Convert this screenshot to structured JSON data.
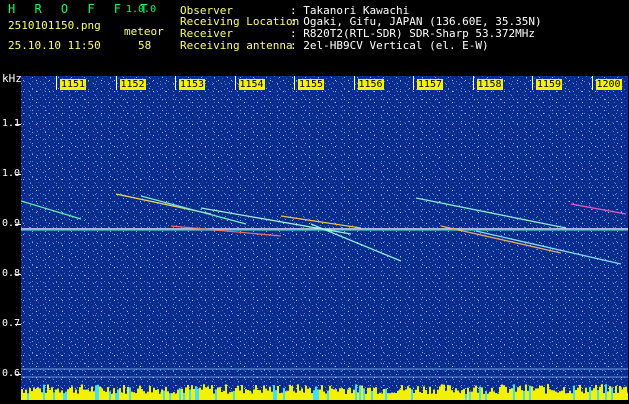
{
  "header": {
    "app_title": "H R O F F T",
    "app_version": "1.0.0",
    "filename": "2510101150.png",
    "datetime": "25.10.10 11:50",
    "meteor_label": "meteor",
    "meteor_count": "58",
    "info": [
      {
        "label": "Observer",
        "value": ": Takanori Kawachi"
      },
      {
        "label": "Receiving Location",
        "value": ": Ogaki, Gifu, JAPAN (136.60E, 35.35N)"
      },
      {
        "label": "Receiver",
        "value": ": R820T2(RTL-SDR) SDR-Sharp 53.372MHz"
      },
      {
        "label": "Receiving antenna",
        "value": ": 2el-HB9CV Vertical (el. E-W)"
      }
    ]
  },
  "axis": {
    "units": "kHz",
    "y_labels": [
      "1.1",
      "1.0",
      "0.9",
      "0.8",
      "0.7",
      "0.6"
    ],
    "x_labels": [
      "1151",
      "1152",
      "1153",
      "1154",
      "1155",
      "1156",
      "1157",
      "1158",
      "1159",
      "1200"
    ]
  },
  "colors": {
    "background": "#000000",
    "spectrogram": "#0a2a8c",
    "carrier": "#ffffff",
    "tick_label_bg": "#f4f400",
    "title_green": "#00ff66",
    "text_yellow": "#ffff66"
  }
}
